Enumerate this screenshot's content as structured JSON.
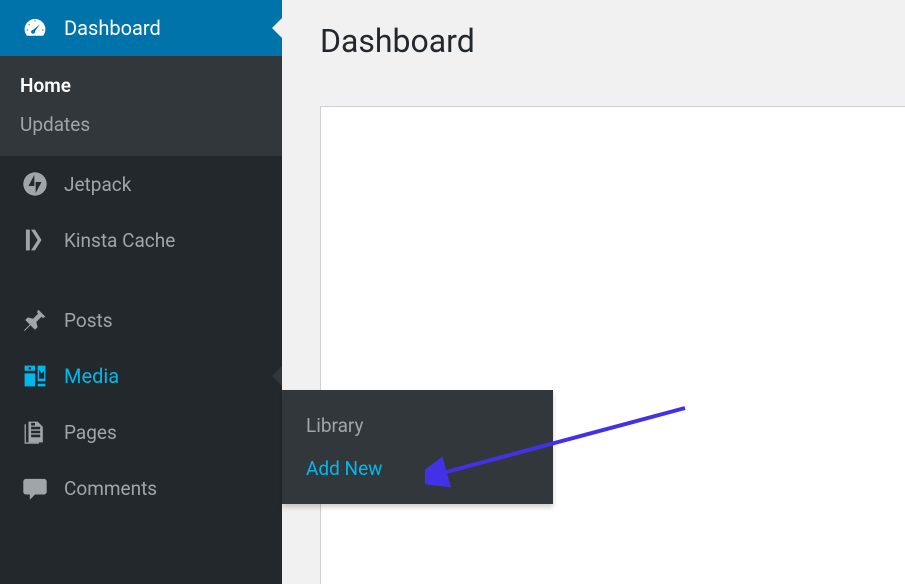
{
  "page": {
    "title": "Dashboard"
  },
  "sidebar": {
    "dashboard": {
      "label": "Dashboard"
    },
    "submenu": {
      "home": "Home",
      "updates": "Updates"
    },
    "jetpack": {
      "label": "Jetpack"
    },
    "kinsta": {
      "label": "Kinsta Cache"
    },
    "posts": {
      "label": "Posts"
    },
    "media": {
      "label": "Media"
    },
    "pages": {
      "label": "Pages"
    },
    "comments": {
      "label": "Comments"
    }
  },
  "flyout": {
    "library": "Library",
    "addnew": "Add New"
  }
}
